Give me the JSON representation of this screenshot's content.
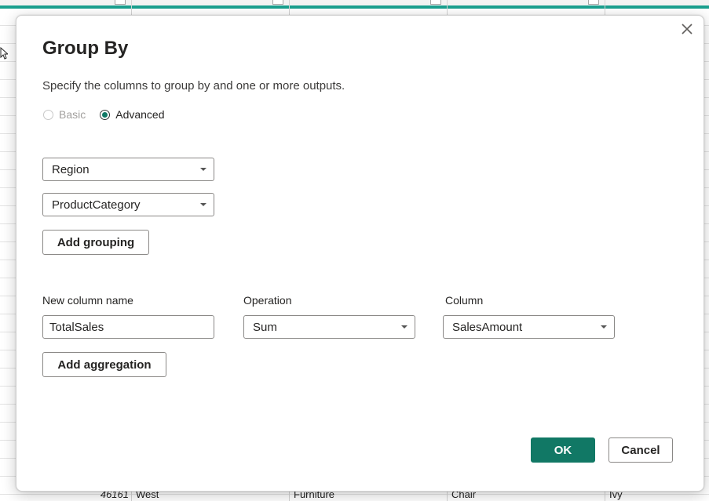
{
  "background": {
    "row": {
      "number": "46161",
      "region": "West",
      "category": "Furniture",
      "product": "Chair",
      "name": "Ivy"
    },
    "accent_color": "#1aa08f"
  },
  "dialog": {
    "title": "Group By",
    "description": "Specify the columns to group by and one or more outputs.",
    "mode": {
      "options": [
        {
          "label": "Basic",
          "checked": false,
          "disabled": true
        },
        {
          "label": "Advanced",
          "checked": true,
          "disabled": false
        }
      ]
    },
    "groupings": [
      {
        "value": "Region"
      },
      {
        "value": "ProductCategory"
      }
    ],
    "add_grouping_label": "Add grouping",
    "aggregation": {
      "headers": {
        "new_column_name": "New column name",
        "operation": "Operation",
        "column": "Column"
      },
      "rows": [
        {
          "new_column_name": "TotalSales",
          "operation": "Sum",
          "column": "SalesAmount"
        }
      ]
    },
    "add_aggregation_label": "Add aggregation",
    "ok_label": "OK",
    "cancel_label": "Cancel",
    "primary_color": "#117865"
  }
}
